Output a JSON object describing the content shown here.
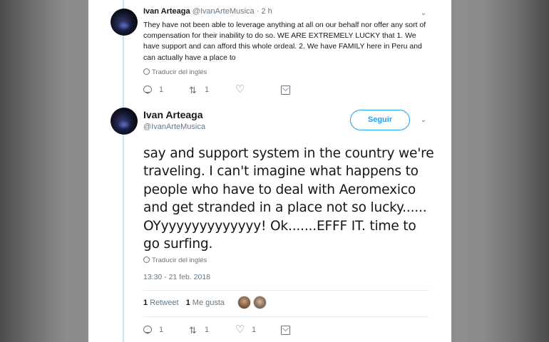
{
  "tweet1": {
    "name": "Ivan Arteaga",
    "handle": "@IvanArteMusica",
    "separator": "·",
    "time": "2 h",
    "text": "They have not been able to leverage anything at all on our behalf nor offer any sort of compensation for their inability to do so. WE ARE EXTREMELY LUCKY that 1. We have support and can afford this whole ordeal. 2. We have FAMILY here in Peru and can actually have a place to",
    "translate": "Traducir del inglés",
    "reply_count": "1",
    "retweet_count": "1",
    "like_count": "",
    "icons": [
      "reply-icon",
      "retweet-icon",
      "like-icon",
      "direct-message-icon",
      "chevron-down-icon",
      "globe-icon"
    ]
  },
  "tweet2": {
    "name": "Ivan Arteaga",
    "handle": "@IvanArteMusica",
    "follow_label": "Seguir",
    "text": "say and support system in the country we're traveling. I can't imagine what happens to people who have to deal with Aeromexico and get stranded in a place not so lucky...... OYyyyyyyyyyyyyy! Ok.......EFFF IT. time to go surfing.",
    "translate": "Traducir del inglés",
    "timestamp": "13:30 - 21 feb. 2018",
    "retweets_num": "1",
    "retweets_label": "Retweet",
    "likes_num": "1",
    "likes_label": "Me gusta",
    "reply_count": "1",
    "retweet_count": "1",
    "like_count": "1"
  },
  "colors": {
    "accent": "#1da1f2",
    "secondary_text": "#657786",
    "primary_text": "#14171a",
    "thread_line": "#c4e3f3"
  }
}
